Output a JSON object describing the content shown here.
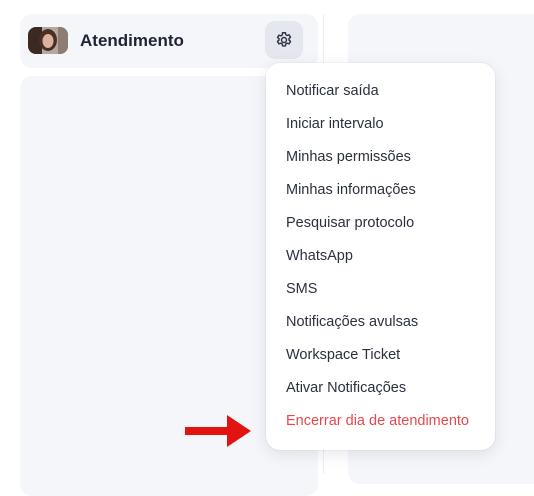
{
  "header": {
    "title": "Atendimento",
    "avatar_icon": "user-avatar-photo",
    "settings_icon": "gear-icon"
  },
  "menu": {
    "items": [
      {
        "label": "Notificar saída"
      },
      {
        "label": "Iniciar intervalo"
      },
      {
        "label": "Minhas permissões"
      },
      {
        "label": "Minhas informações"
      },
      {
        "label": "Pesquisar protocolo"
      },
      {
        "label": "WhatsApp"
      },
      {
        "label": "SMS"
      },
      {
        "label": "Notificações avulsas"
      },
      {
        "label": "Workspace Ticket"
      },
      {
        "label": "Ativar Notificações"
      },
      {
        "label": "Encerrar dia de atendimento"
      }
    ],
    "danger_color": "#e5484d"
  },
  "annotation": {
    "arrow_color": "#e3140f",
    "arrow_icon": "arrow-right-icon"
  }
}
